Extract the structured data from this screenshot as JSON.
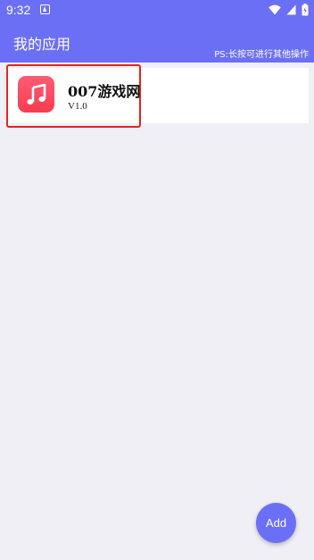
{
  "status_bar": {
    "time": "9:32",
    "icons": [
      "notification-a-icon",
      "wifi-icon",
      "signal-icon",
      "battery-charging-icon"
    ]
  },
  "header": {
    "title": "我的应用",
    "hint": "PS:长按可进行其他操作"
  },
  "apps": [
    {
      "name": "007游戏网",
      "version": "V1.0",
      "icon": "music-note-icon"
    }
  ],
  "fab": {
    "label": "Add"
  },
  "colors": {
    "accent": "#6b6ff5",
    "background": "#efeff5",
    "highlight": "#e5231d",
    "app_icon": "#f93b50"
  }
}
